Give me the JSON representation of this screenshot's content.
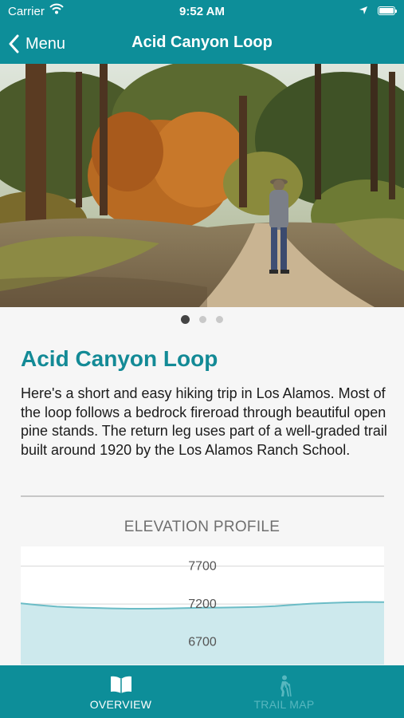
{
  "status_bar": {
    "carrier": "Carrier",
    "time": "9:52 AM",
    "icons": [
      "wifi-icon",
      "location-arrow-icon",
      "battery-icon"
    ]
  },
  "nav": {
    "back_label": "Menu",
    "title": "Acid Canyon Loop",
    "color": "#0d8e99"
  },
  "gallery": {
    "image_subject": "photo",
    "page_count": 3,
    "current_page": 1
  },
  "content": {
    "title": "Acid Canyon Loop",
    "description": "Here's a short and easy hiking trip in Los Alamos. Most of the loop follows a bedrock fireroad through beautiful open pine stands. The return leg uses part of a well-graded trail built around 1920 by the Los Alamos Ranch School.",
    "title_color": "#138a96"
  },
  "elevation": {
    "header": "ELEVATION PROFILE",
    "tick_labels": [
      "7700",
      "7200",
      "6700"
    ],
    "chart_data": {
      "type": "area",
      "ylabel": "",
      "xlabel": "",
      "yticks": [
        7700,
        7200,
        6700
      ],
      "ylim": [
        6400,
        7960
      ],
      "x": [
        0,
        5,
        10,
        15,
        20,
        25,
        30,
        35,
        40,
        45,
        50,
        55,
        60,
        65,
        70,
        75,
        80,
        85,
        90,
        95,
        100
      ],
      "values": [
        7210,
        7185,
        7165,
        7155,
        7148,
        7142,
        7138,
        7138,
        7140,
        7145,
        7150,
        7153,
        7156,
        7162,
        7172,
        7190,
        7205,
        7215,
        7222,
        7226,
        7225
      ],
      "line_color": "#6bbcc6",
      "fill_color": "#cde9ed"
    }
  },
  "tabs": [
    {
      "label": "OVERVIEW",
      "icon": "book-icon",
      "selected": true
    },
    {
      "label": "TRAIL MAP",
      "icon": "hiker-icon",
      "selected": false
    }
  ]
}
